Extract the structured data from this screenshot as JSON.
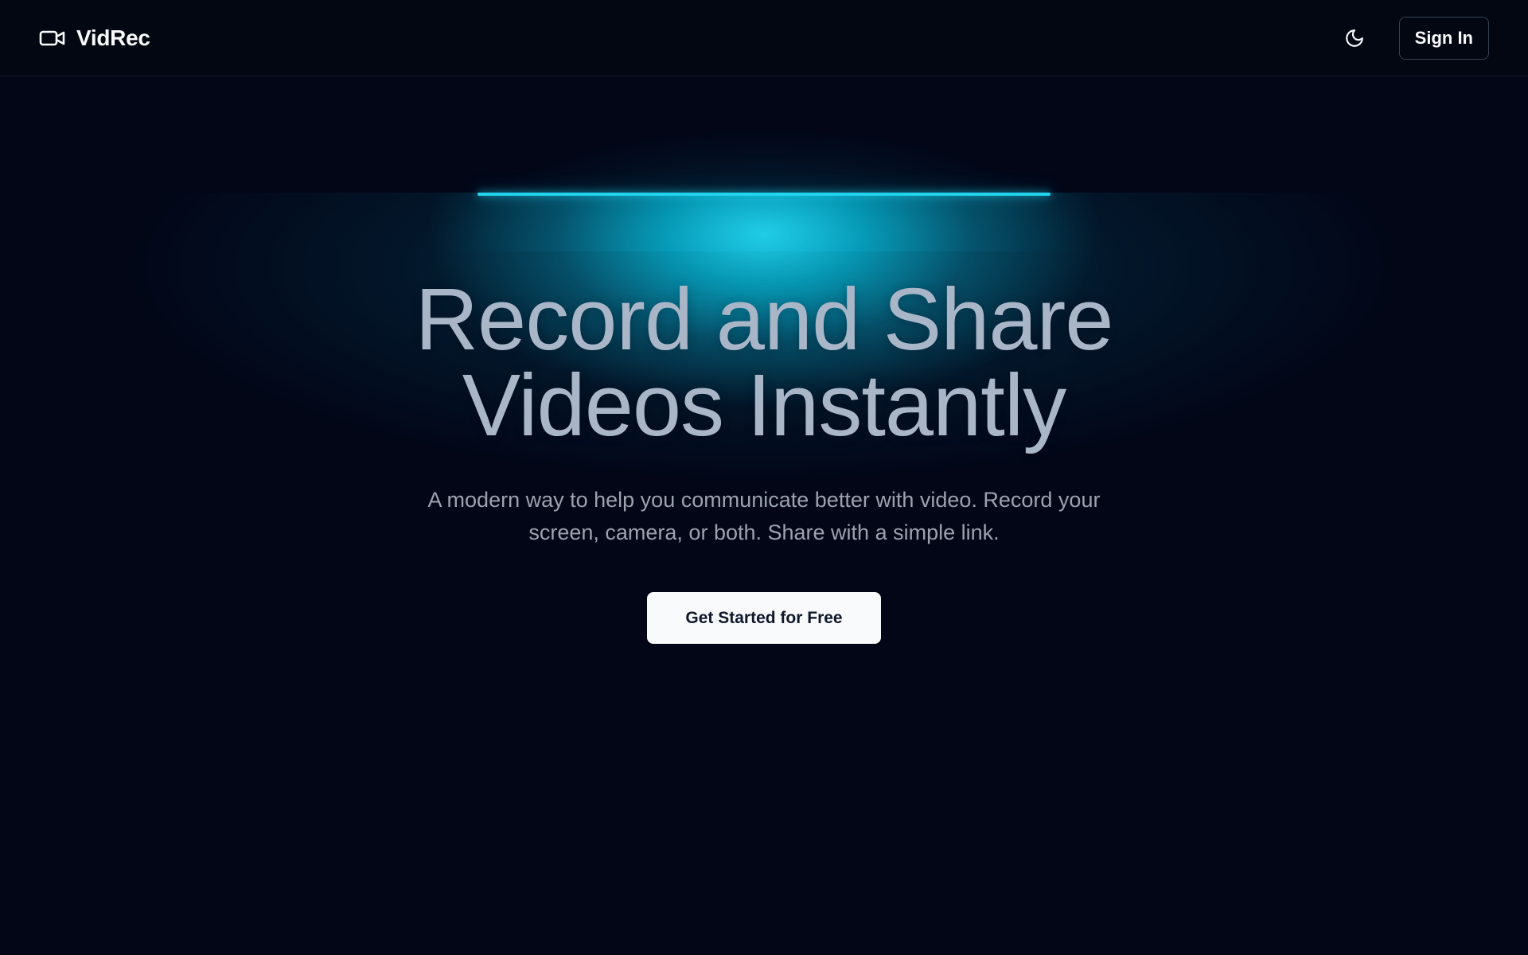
{
  "header": {
    "brand_name": "VidRec",
    "brand_icon": "video-camera-icon",
    "theme_toggle_icon": "moon-icon",
    "signin_label": "Sign In"
  },
  "hero": {
    "title_line_1": "Record and Share",
    "title_line_2": "Videos Instantly",
    "subtitle_line_1": "A modern way to help you communicate better with video. Record your",
    "subtitle_line_2": "screen, camera, or both. Share with a simple link.",
    "cta_label": "Get Started for Free"
  },
  "colors": {
    "background": "#020617",
    "accent": "#22d3ee",
    "title_text": "#a9b6c8",
    "subtitle_text": "#9ca3af",
    "cta_background": "#f8fafc"
  }
}
